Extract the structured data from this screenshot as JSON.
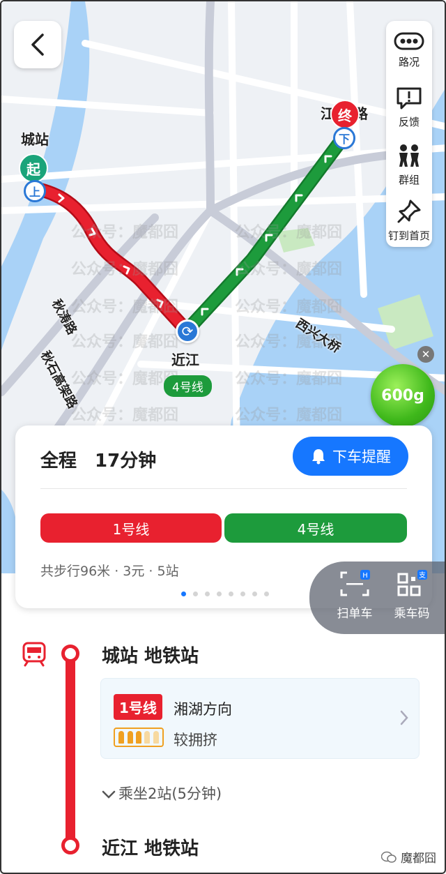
{
  "toolbar": {
    "traffic": "路况",
    "feedback": "反馈",
    "group": "群组",
    "pin": "钉到首页"
  },
  "map": {
    "start_station": "城站",
    "start_pin": "起",
    "start_board": "上",
    "end_station": "江",
    "end_station_suffix": "路",
    "end_pin": "终",
    "end_alight": "下",
    "transfer_station": "近江",
    "transfer_line": "4号线",
    "roads": [
      "秋涛路",
      "秋石高架路",
      "西兴大桥"
    ],
    "energy": "600g",
    "watermark": "公众号：魔都囧"
  },
  "summary": {
    "total_label": "全程",
    "duration": "17分钟",
    "alight_reminder": "下车提醒",
    "segments": [
      {
        "label": "1号线",
        "color": "#e8212f"
      },
      {
        "label": "4号线",
        "color": "#1d9b3c"
      }
    ],
    "details": "共步行96米 · 3元 · 5站",
    "pages": 8,
    "active_page": 0
  },
  "side": {
    "scan": "扫单车",
    "ride_code": "乘车码"
  },
  "route": {
    "board_stop": "城站  地铁站",
    "line_badge": "1号线",
    "direction": "湘湖方向",
    "crowd": "较拥挤",
    "ride_info": "乘坐2站(5分钟)",
    "alight_stop": "近江  地铁站"
  },
  "brand": "魔都囧",
  "colors": {
    "line1": "#e8212f",
    "line4": "#1d9b3c",
    "accent": "#1677ff"
  }
}
